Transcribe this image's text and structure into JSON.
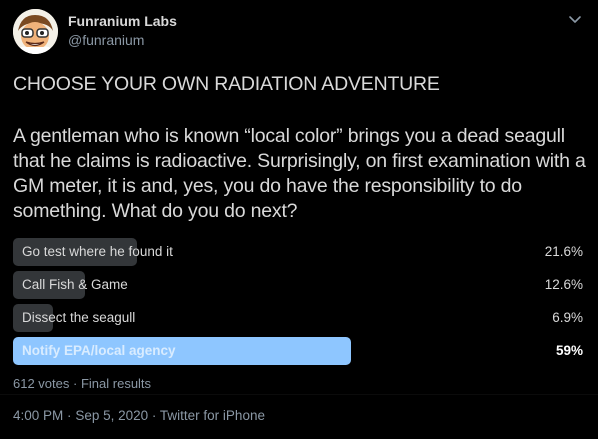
{
  "author": {
    "name": "Funranium Labs",
    "handle": "@funranium",
    "avatar_icon": "cartoon-scientist-avatar"
  },
  "menu_icon": "chevron-down-icon",
  "title": "CHOOSE YOUR OWN RADIATION ADVENTURE",
  "body": "A gentleman who is known “local color” brings you a dead seagull that he claims is radioactive. Surprisingly, on first examination with a GM meter, it is and, yes, you do have the responsibility to do something. What do you do next?",
  "poll": {
    "options": [
      {
        "label": "Go test where he found it",
        "percent": "21.6%",
        "fraction": 0.216,
        "winner": false
      },
      {
        "label": "Call Fish & Game",
        "percent": "12.6%",
        "fraction": 0.126,
        "winner": false
      },
      {
        "label": "Dissect the seagull",
        "percent": "6.9%",
        "fraction": 0.069,
        "winner": false
      },
      {
        "label": "Notify EPA/local agency",
        "percent": "59%",
        "fraction": 0.59,
        "winner": true
      }
    ],
    "votes": "612 votes",
    "status": "Final results"
  },
  "timestamp": {
    "time": "4:00 PM",
    "date": "Sep 5, 2020",
    "source": "Twitter for iPhone"
  },
  "colors": {
    "background": "#000000",
    "bar": "#333639",
    "winner_bar": "#8ec6ff",
    "secondary_text": "#8b98a5"
  }
}
